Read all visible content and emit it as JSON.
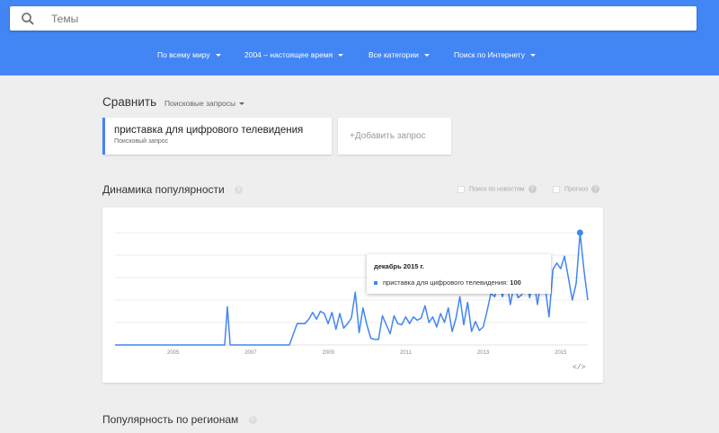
{
  "search": {
    "placeholder": "Темы",
    "value": ""
  },
  "filters": {
    "region": "По всему миру",
    "period": "2004 – настоящее время",
    "category": "Все категории",
    "source": "Поиск по Интернету"
  },
  "compare": {
    "title": "Сравнить",
    "subtitle": "Поисковые запросы",
    "term": "приставка для цифрового телевидения",
    "term_type": "Поисковый запрос",
    "add_label": "+Добавить запрос"
  },
  "interest": {
    "title": "Динамика популярности",
    "help": "?",
    "news_option": "Поиск по новостям",
    "forecast_option": "Прогноз"
  },
  "tooltip": {
    "date": "декабрь 2015 г.",
    "series_label": "приставка для цифрового телевидения:",
    "value": "100"
  },
  "embed_label": "</>",
  "region_section": {
    "title": "Популярность по регионам"
  },
  "colors": {
    "accent": "#4285f4",
    "background": "#eeeeee"
  },
  "chart_data": {
    "type": "line",
    "x_tick_labels": [
      "2005",
      "2007",
      "2009",
      "2011",
      "2013",
      "2015"
    ],
    "ylim": [
      0,
      100
    ],
    "grid": true,
    "series": [
      {
        "name": "приставка для цифрового телевидения",
        "x": [
          2004.0,
          2004.5,
          2005.0,
          2005.5,
          2006.0,
          2006.5,
          2006.83,
          2006.9,
          2006.97,
          2007.5,
          2008.0,
          2008.08,
          2008.17,
          2008.5,
          2008.7,
          2008.8,
          2008.9,
          2009.0,
          2009.1,
          2009.2,
          2009.3,
          2009.4,
          2009.5,
          2009.6,
          2009.7,
          2009.8,
          2009.9,
          2010.0,
          2010.1,
          2010.2,
          2010.3,
          2010.4,
          2010.5,
          2010.6,
          2010.7,
          2010.8,
          2010.9,
          2011.0,
          2011.1,
          2011.2,
          2011.3,
          2011.4,
          2011.5,
          2011.6,
          2011.7,
          2011.8,
          2011.9,
          2012.0,
          2012.1,
          2012.2,
          2012.3,
          2012.4,
          2012.5,
          2012.6,
          2012.7,
          2012.8,
          2012.9,
          2013.0,
          2013.1,
          2013.2,
          2013.3,
          2013.4,
          2013.5,
          2013.6,
          2013.7,
          2013.8,
          2013.9,
          2014.0,
          2014.1,
          2014.2,
          2014.3,
          2014.4,
          2014.5,
          2014.6,
          2014.7,
          2014.8,
          2014.9,
          2015.0,
          2015.1,
          2015.2,
          2015.3,
          2015.4,
          2015.5,
          2015.6,
          2015.7,
          2015.8,
          2015.9,
          2016.0,
          2016.1,
          2016.2
        ],
        "y": [
          0,
          0,
          0,
          0,
          0,
          0,
          0,
          34,
          0,
          0,
          0,
          0,
          0,
          0,
          19,
          19,
          19,
          23,
          29,
          23,
          30,
          28,
          19,
          29,
          14,
          28,
          15,
          19,
          24,
          47,
          11,
          33,
          18,
          6,
          5,
          5,
          26,
          18,
          10,
          26,
          19,
          18,
          25,
          19,
          25,
          22,
          24,
          35,
          20,
          25,
          16,
          28,
          20,
          33,
          12,
          24,
          43,
          18,
          38,
          12,
          21,
          13,
          16,
          30,
          46,
          43,
          58,
          43,
          59,
          36,
          54,
          42,
          45,
          64,
          42,
          60,
          36,
          59,
          51,
          25,
          67,
          73,
          68,
          79,
          60,
          40,
          55,
          100,
          67,
          40
        ]
      }
    ]
  }
}
